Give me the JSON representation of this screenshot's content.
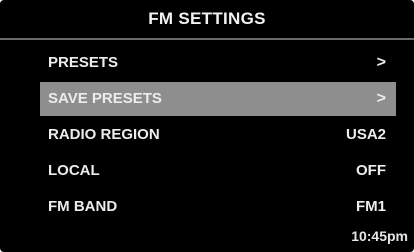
{
  "screen": {
    "title": "FM SETTINGS",
    "menu": [
      {
        "label": "PRESETS",
        "value": ">",
        "selected": false
      },
      {
        "label": "SAVE PRESETS",
        "value": ">",
        "selected": true
      },
      {
        "label": "RADIO REGION",
        "value": "USA2",
        "selected": false
      },
      {
        "label": "LOCAL",
        "value": "OFF",
        "selected": false
      },
      {
        "label": "FM BAND",
        "value": "FM1",
        "selected": false
      }
    ],
    "clock": "10:45pm"
  },
  "colors": {
    "background": "#000000",
    "text": "#ececec",
    "selection_highlight": "#8e8e8e"
  }
}
